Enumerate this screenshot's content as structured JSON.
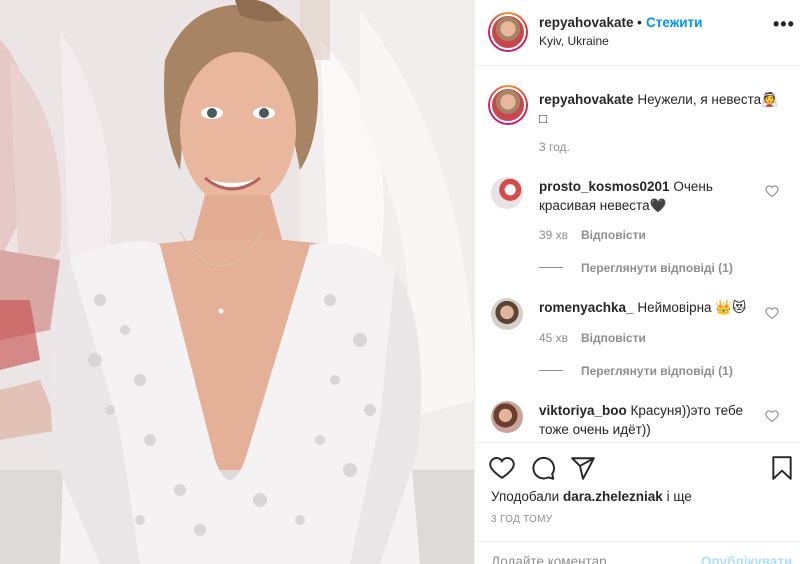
{
  "photo": {
    "alt": ""
  },
  "header": {
    "username": "repyahovakate",
    "separator": "•",
    "follow_label": "Стежити",
    "location": "Kyiv, Ukraine",
    "more_icon": "more-options-icon",
    "more_glyph": "•••"
  },
  "caption": {
    "username": "repyahovakate",
    "text": "Неужели, я невеста👰",
    "emoji_box": "□",
    "time": "3 год."
  },
  "comments": [
    {
      "username": "prosto_kosmos0201",
      "text": "Очень красивая невеста🖤",
      "time": "39 хв",
      "reply_label": "Відповісти",
      "view_replies": "Переглянути відповіді (1)"
    },
    {
      "username": "romenyachka_",
      "text": "Неймовірна 👑😻",
      "time": "45 хв",
      "reply_label": "Відповісти",
      "view_replies": "Переглянути відповіді (1)"
    },
    {
      "username": "viktoriya_boo",
      "text": "Красуня))это тебе тоже очень идёт))"
    }
  ],
  "actions": {
    "icons": [
      "heart-icon",
      "comment-icon",
      "share-icon",
      "bookmark-icon"
    ],
    "likes_prefix": "Уподобали",
    "likes_user": "dara.zhelezniak",
    "likes_suffix": "і ще",
    "timestamp": "3 ГОД ТОМУ"
  },
  "add_comment": {
    "placeholder": "Додайте коментар...",
    "publish_label": "Опублікувати"
  },
  "colors": {
    "follow": "#0095f6",
    "meta_text": "#8e8e8e",
    "publish_disabled": "#b2dffc",
    "border": "#efefef"
  }
}
